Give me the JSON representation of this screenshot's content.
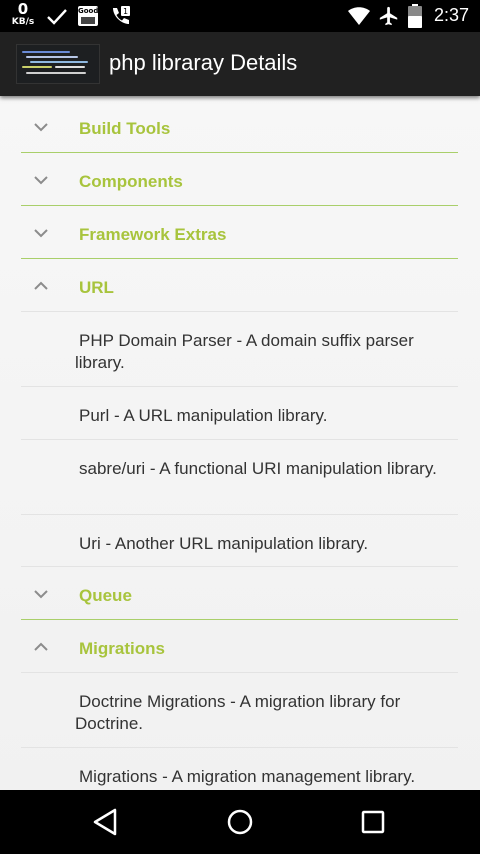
{
  "status_bar": {
    "net_speed_value": "0",
    "net_speed_unit": "KB/s",
    "notification_badge": "Good",
    "time": "2:37"
  },
  "action_bar": {
    "title": "php libraray Details"
  },
  "list": {
    "groups": [
      {
        "label": "Build Tools",
        "expanded": false
      },
      {
        "label": "Components",
        "expanded": false
      },
      {
        "label": "Framework Extras",
        "expanded": false
      },
      {
        "label": "URL",
        "expanded": true,
        "children": [
          "PHP Domain Parser - A domain suffix parser library.",
          "Purl - A URL manipulation library.",
          "sabre/uri - A functional URI manipulation library.",
          "Uri - Another URL manipulation library."
        ]
      },
      {
        "label": "Queue",
        "expanded": false
      },
      {
        "label": "Migrations",
        "expanded": true,
        "children": [
          "Doctrine Migrations - A migration library for Doctrine.",
          "Migrations - A migration management library."
        ]
      }
    ]
  },
  "colors": {
    "accent": "#a8c43d",
    "divider": "#a9cf6a",
    "action_bar": "#212121"
  }
}
